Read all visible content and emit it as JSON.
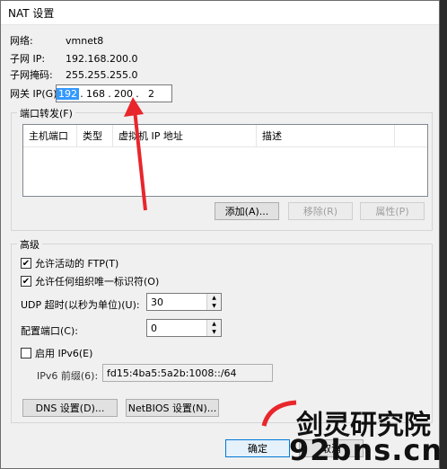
{
  "window": {
    "title": "NAT 设置"
  },
  "info": {
    "network_label": "网络:",
    "network_value": "vmnet8",
    "subnet_ip_label": "子网 IP:",
    "subnet_ip_value": "192.168.200.0",
    "mask_label": "子网掩码:",
    "mask_value": "255.255.255.0",
    "gateway_label": "网关 IP(G):",
    "gateway_octets": [
      "192",
      "168",
      "200",
      "2"
    ]
  },
  "port_forward": {
    "title": "端口转发(F)",
    "columns": [
      "主机端口",
      "类型",
      "虚拟机 IP 地址",
      "描述"
    ],
    "add_button": "添加(A)...",
    "remove_button": "移除(R)",
    "props_button": "属性(P)"
  },
  "advanced": {
    "title": "高级",
    "allow_ftp": "允许活动的 FTP(T)",
    "allow_uid": "允许任何组织唯一标识符(O)",
    "udp_timeout_label": "UDP 超时(以秒为单位)(U):",
    "udp_timeout_value": "30",
    "config_port_label": "配置端口(C):",
    "config_port_value": "0",
    "enable_ipv6": "启用 IPv6(E)",
    "ipv6_prefix_label": "IPv6 前缀(6):",
    "ipv6_prefix_value": "fd15:4ba5:5a2b:1008::/64"
  },
  "buttons": {
    "dns": "DNS 设置(D)...",
    "netbios": "NetBIOS 设置(N)...",
    "ok": "确定",
    "cancel": "取消"
  },
  "watermark": {
    "line1": "剑灵研究院",
    "line2": "92bns.cn"
  },
  "colors": {
    "arrow": "#e8262c",
    "selection": "#3399ff",
    "watermark_dark": "#111111",
    "watermark_red": "#e8262c"
  }
}
